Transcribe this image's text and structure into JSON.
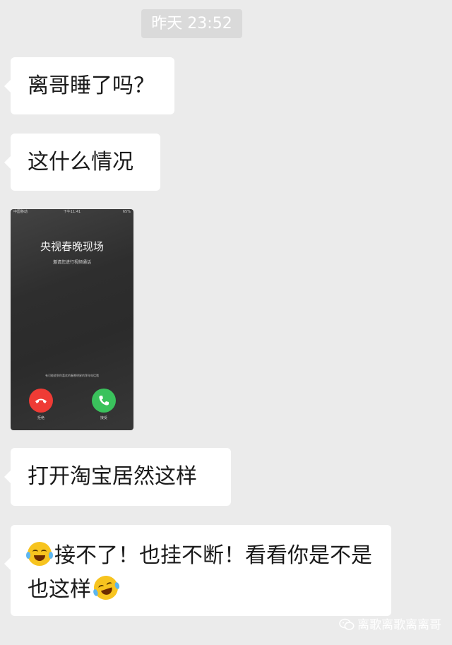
{
  "timestamp": "昨天 23:52",
  "messages": [
    {
      "text": "离哥睡了吗？"
    },
    {
      "text": "这什么情况"
    },
    {
      "text": "打开淘宝居然这样"
    },
    {
      "text_part1": "接不了！也挂不断！看看你是不是也这样"
    }
  ],
  "photo": {
    "status_left": "中国移动",
    "status_time": "下午11:41",
    "status_right": "65%",
    "caller": "央视春晚现场",
    "subtitle": "邀请您进行视频通话",
    "hint": "有可能收到你喜欢的春晚明星的拜年电话哦",
    "decline_label": "拒绝",
    "accept_label": "接受"
  },
  "watermark": "离歌离歌离离哥",
  "colors": {
    "background": "#ebebeb",
    "bubble": "#ffffff",
    "decline": "#ef3b35",
    "accept": "#3ac25c"
  }
}
